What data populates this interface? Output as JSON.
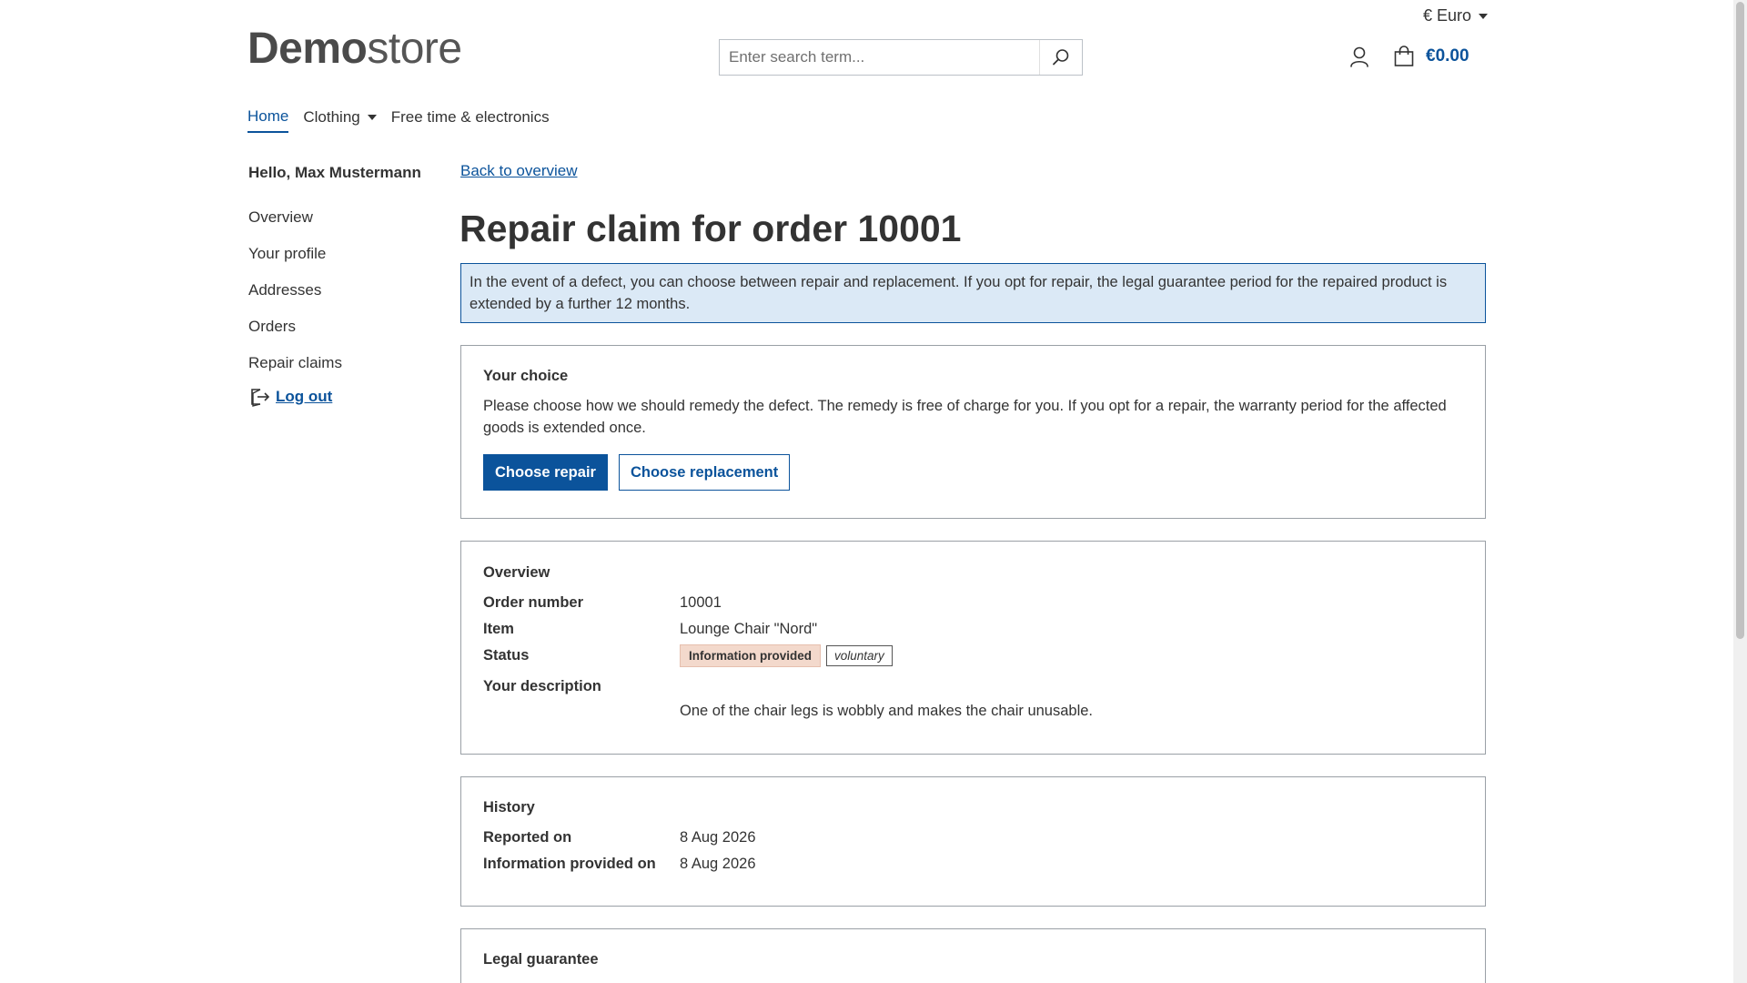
{
  "header": {
    "currency": "€ Euro",
    "logo_bold": "Demo",
    "logo_light": "store",
    "search_placeholder": "Enter search term...",
    "cart_total": "€0.00"
  },
  "nav": {
    "home": "Home",
    "clothing": "Clothing",
    "free_time": "Free time & electronics"
  },
  "sidebar": {
    "greeting": "Hello, Max Mustermann",
    "links": [
      "Overview",
      "Your profile",
      "Addresses",
      "Orders",
      "Repair claims"
    ],
    "logout": "Log out"
  },
  "main": {
    "back": "Back to overview",
    "title": "Repair claim for order 10001",
    "info": "In the event of a defect, you can choose between repair and replacement. If you opt for repair, the legal guarantee period for the repaired product is extended by a further 12 months.",
    "choice": {
      "title": "Your choice",
      "text": "Please choose how we should remedy the defect. The remedy is free of charge for you. If you opt for a repair, the warranty period for the affected goods is extended once.",
      "repair_btn": "Choose repair",
      "replace_btn": "Choose replacement"
    },
    "overview": {
      "title": "Overview",
      "order_label": "Order number",
      "order_value": "10001",
      "item_label": "Item",
      "item_value": "Lounge Chair \"Nord\"",
      "status_label": "Status",
      "status_badge": "Information provided",
      "status_tag": "voluntary",
      "desc_label": "Your description",
      "desc_value": "One of the chair legs is wobbly and makes the chair unusable."
    },
    "history": {
      "title": "History",
      "reported_label": "Reported on",
      "reported_value": "8 Aug 2026",
      "info_label": "Information provided on",
      "info_value": "8 Aug 2026"
    },
    "legal": {
      "title": "Legal guarantee"
    }
  }
}
